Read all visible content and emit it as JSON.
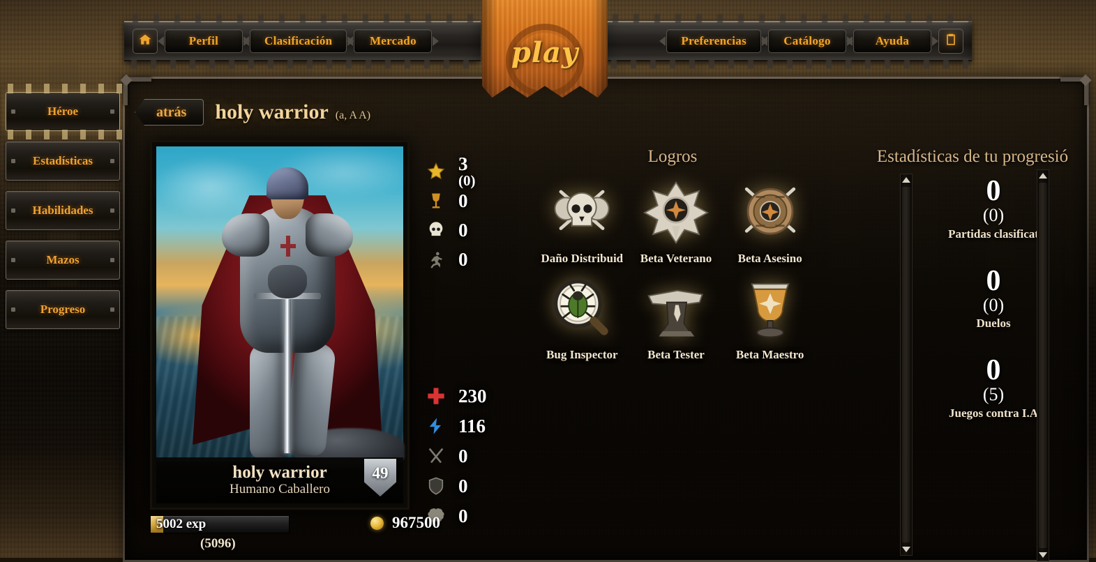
{
  "topnav": {
    "home_icon": "home-icon",
    "book_icon": "book-icon",
    "left_items": [
      {
        "label": "Perfil"
      },
      {
        "label": "Clasificación"
      },
      {
        "label": "Mercado"
      }
    ],
    "right_items": [
      {
        "label": "Preferencias"
      },
      {
        "label": "Catálogo"
      },
      {
        "label": "Ayuda"
      }
    ],
    "play_label": "play"
  },
  "sidebar": {
    "items": [
      {
        "label": "Héroe",
        "active": true
      },
      {
        "label": "Estadísticas",
        "active": false
      },
      {
        "label": "Habilidades",
        "active": false
      },
      {
        "label": "Mazos",
        "active": false
      },
      {
        "label": "Progreso",
        "active": false
      }
    ]
  },
  "header": {
    "back_label": "atrás",
    "hero_name": "holy warrior",
    "hero_tag": "(a, A A)"
  },
  "character": {
    "name": "holy warrior",
    "race_class": "Humano Caballero",
    "level": "49",
    "portrait_alt": "knight-in-silver-armor-with-red-cape"
  },
  "stats_top": [
    {
      "icon": "star-icon",
      "value": "3",
      "paren": "(0)"
    },
    {
      "icon": "goblet-icon",
      "value": "0",
      "paren": ""
    },
    {
      "icon": "skull-icon",
      "value": "0",
      "paren": ""
    },
    {
      "icon": "runner-icon",
      "value": "0",
      "paren": ""
    }
  ],
  "stats_bottom": [
    {
      "icon": "health-cross-icon",
      "value": "230",
      "paren": ""
    },
    {
      "icon": "energy-bolt-icon",
      "value": "116",
      "paren": ""
    },
    {
      "icon": "crossed-swords-icon",
      "value": "0",
      "paren": ""
    },
    {
      "icon": "shield-icon",
      "value": "0",
      "paren": ""
    },
    {
      "icon": "brain-icon",
      "value": "0",
      "paren": ""
    }
  ],
  "achievements": {
    "title": "Logros",
    "items": [
      {
        "label": "Daño Distribuid",
        "icon": "skull-crossed-swords-badge"
      },
      {
        "label": "Beta Veterano",
        "icon": "star-medal-badge"
      },
      {
        "label": "Beta Asesino",
        "icon": "round-shield-swords-badge"
      },
      {
        "label": "Bug Inspector",
        "icon": "magnifier-beetle-badge"
      },
      {
        "label": "Beta Tester",
        "icon": "anvil-badge"
      },
      {
        "label": "Beta Maestro",
        "icon": "chalice-badge"
      }
    ]
  },
  "progression": {
    "title": "Estadísticas de tu progresió",
    "items": [
      {
        "value": "0",
        "paren": "(0)",
        "label": "Partidas clasificat"
      },
      {
        "value": "0",
        "paren": "(0)",
        "label": "Duelos"
      },
      {
        "value": "0",
        "paren": "(5)",
        "label": "Juegos contra I.A"
      }
    ]
  },
  "footer": {
    "exp_text": "5002 exp",
    "exp_paren": "(5096)",
    "gold_value": "967500",
    "gold_icon": "gold-coin-icon"
  },
  "colors": {
    "accent_gold": "#f0a62c",
    "title_cream": "#f3d49a",
    "panel_dark": "#0c0905",
    "health_red": "#d93333",
    "energy_blue": "#2e8de0"
  }
}
